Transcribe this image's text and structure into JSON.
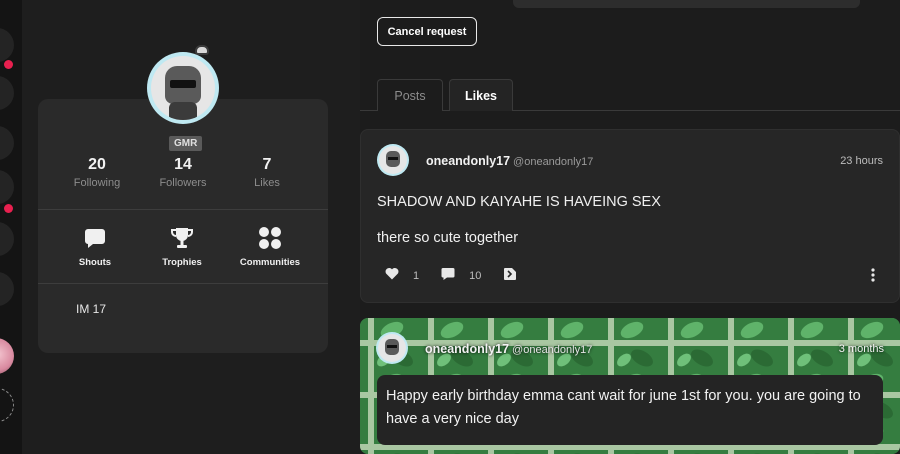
{
  "profile": {
    "badge": "GMR",
    "stats": [
      {
        "value": "20",
        "label": "Following"
      },
      {
        "value": "14",
        "label": "Followers"
      },
      {
        "value": "7",
        "label": "Likes"
      }
    ],
    "features": [
      {
        "label": "Shouts",
        "icon": "chat-bubble-icon"
      },
      {
        "label": "Trophies",
        "icon": "trophy-icon"
      },
      {
        "label": "Communities",
        "icon": "grid-dots-icon"
      }
    ],
    "bio": "IM 17"
  },
  "main": {
    "cancel_label": "Cancel request",
    "tabs": [
      {
        "label": "Posts",
        "active": false
      },
      {
        "label": "Likes",
        "active": true
      }
    ],
    "posts": [
      {
        "username": "oneandonly17",
        "handle": "@oneandonly17",
        "time": "23 hours",
        "title": "SHADOW AND KAIYAHE IS HAVEING SEX",
        "body": "there so cute together",
        "likes": "1",
        "comments": "10"
      },
      {
        "username": "oneandonly17",
        "handle": "@oneandonly17",
        "time": "3 months",
        "body": "Happy early birthday emma cant wait for june 1st for you. you are going to have a very nice day"
      }
    ]
  },
  "colors": {
    "accent_dot": "#e8204f",
    "avatar_ring": "#bfe9f2",
    "post_green": "#3c8a48"
  }
}
